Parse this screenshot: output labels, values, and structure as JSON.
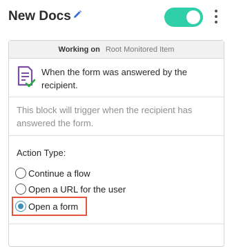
{
  "header": {
    "title": "New Docs",
    "edit_icon": "pencil-icon",
    "toggle_on": true,
    "menu_icon": "kebab-menu-icon"
  },
  "card": {
    "working_on_label": "Working on",
    "working_on_value": "Root Monitored Item",
    "trigger": {
      "icon": "form-check-icon",
      "text": "When the form was answered by the recipient."
    },
    "description": "This block will trigger when the recipient has answered the form.",
    "action_type_label": "Action Type:",
    "options": [
      {
        "label": "Continue a flow",
        "selected": false
      },
      {
        "label": "Open a URL for the user",
        "selected": false
      },
      {
        "label": "Open a form",
        "selected": true
      }
    ]
  },
  "colors": {
    "toggle": "#2ecfa9",
    "pencil": "#3a6fd8",
    "icon_purple": "#7a4fa3",
    "icon_check": "#2aa84a",
    "radio_selected": "#3a8fb7",
    "highlight": "#e5533d"
  }
}
